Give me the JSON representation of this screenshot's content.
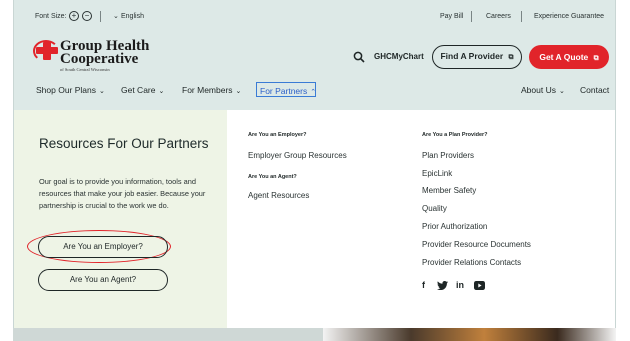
{
  "utility": {
    "font_size_label": "Font Size:",
    "language": "English",
    "pay_bill": "Pay Bill",
    "careers": "Careers",
    "experience_guarantee": "Experience Guarantee"
  },
  "logo": {
    "line1": "Group Health",
    "line2": "Cooperative",
    "sub": "of South Central Wisconsin"
  },
  "header": {
    "ghcmychart": "GHCMyChart",
    "find_provider": "Find A Provider",
    "get_quote": "Get A Quote"
  },
  "nav": {
    "shop": "Shop Our Plans",
    "care": "Get Care",
    "members": "For Members",
    "partners": "For Partners",
    "about": "About Us",
    "contact": "Contact"
  },
  "dropdown": {
    "title": "Resources For Our Partners",
    "description": "Our goal is to provide you information, tools and resources that make your job easier. Because your partnership is crucial to the work we do.",
    "employer_button": "Are You an Employer?",
    "agent_button": "Are You an Agent?",
    "col1": {
      "employer_heading": "Are You an Employer?",
      "employer_link": "Employer Group Resources",
      "agent_heading": "Are You an Agent?",
      "agent_link": "Agent Resources"
    },
    "col2": {
      "heading": "Are You a Plan Provider?",
      "links": [
        "Plan Providers",
        "EpicLink",
        "Member Safety",
        "Quality",
        "Prior Authorization",
        "Provider Resource Documents",
        "Provider Relations Contacts"
      ]
    },
    "social": {
      "facebook": "f",
      "twitter": "twitter-icon",
      "linkedin": "in",
      "youtube": "youtube-icon"
    }
  },
  "colors": {
    "brand_red": "#e1242a",
    "header_bg": "#dde9e7",
    "panel_bg": "#eef4e6"
  }
}
